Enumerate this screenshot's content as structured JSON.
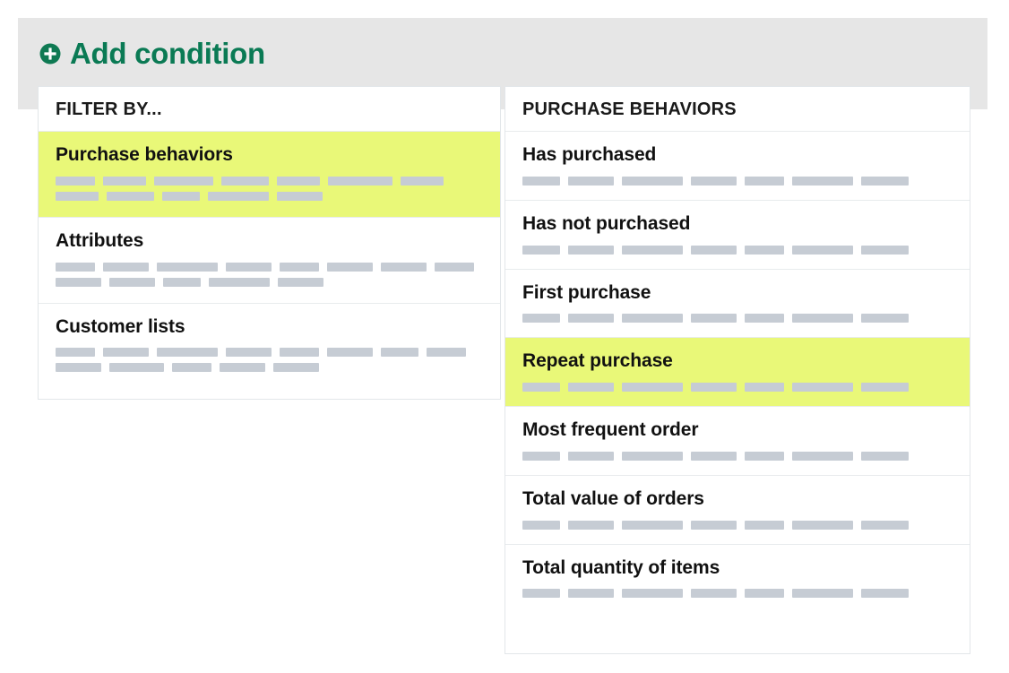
{
  "colors": {
    "backdrop": "#e6e6e6",
    "accent_green": "#0a7a54",
    "highlight_yellow": "#e9f878",
    "skeleton_gray": "#c6ccd4",
    "panel_border": "#e2e6e9",
    "text_primary": "#111111"
  },
  "header": {
    "add_condition_label": "Add condition",
    "plus_icon": "plus-circle-icon"
  },
  "left_panel": {
    "header": "FILTER BY...",
    "items": [
      {
        "label": "Purchase behaviors",
        "selected": true,
        "skeleton": [
          [
            44,
            48,
            66,
            53,
            48,
            72,
            48
          ],
          [
            48,
            53,
            42,
            68,
            51
          ]
        ]
      },
      {
        "label": "Attributes",
        "selected": false,
        "skeleton": [
          [
            44,
            51,
            68,
            51,
            44,
            51,
            51,
            44
          ],
          [
            51,
            51,
            42,
            68,
            51
          ]
        ]
      },
      {
        "label": "Customer lists",
        "selected": false,
        "skeleton": [
          [
            44,
            51,
            68,
            51,
            44,
            51,
            42,
            44
          ],
          [
            51,
            61,
            44,
            51,
            51
          ]
        ]
      }
    ]
  },
  "right_panel": {
    "header": "PURCHASE BEHAVIORS",
    "items": [
      {
        "label": "Has purchased",
        "selected": false,
        "skeleton": [
          [
            42,
            51,
            68,
            51,
            44,
            68,
            53
          ]
        ]
      },
      {
        "label": "Has not purchased",
        "selected": false,
        "skeleton": [
          [
            42,
            51,
            68,
            51,
            44,
            68,
            53
          ]
        ]
      },
      {
        "label": "First purchase",
        "selected": false,
        "skeleton": [
          [
            42,
            51,
            68,
            51,
            44,
            68,
            53
          ]
        ]
      },
      {
        "label": "Repeat purchase",
        "selected": true,
        "skeleton": [
          [
            42,
            51,
            68,
            51,
            44,
            68,
            53
          ]
        ]
      },
      {
        "label": "Most frequent order",
        "selected": false,
        "skeleton": [
          [
            42,
            51,
            68,
            51,
            44,
            68,
            53
          ]
        ]
      },
      {
        "label": "Total value of orders",
        "selected": false,
        "skeleton": [
          [
            42,
            51,
            68,
            51,
            44,
            68,
            53
          ]
        ]
      },
      {
        "label": "Total quantity of items",
        "selected": false,
        "skeleton": [
          [
            42,
            51,
            68,
            51,
            44,
            68,
            53
          ]
        ]
      }
    ]
  }
}
